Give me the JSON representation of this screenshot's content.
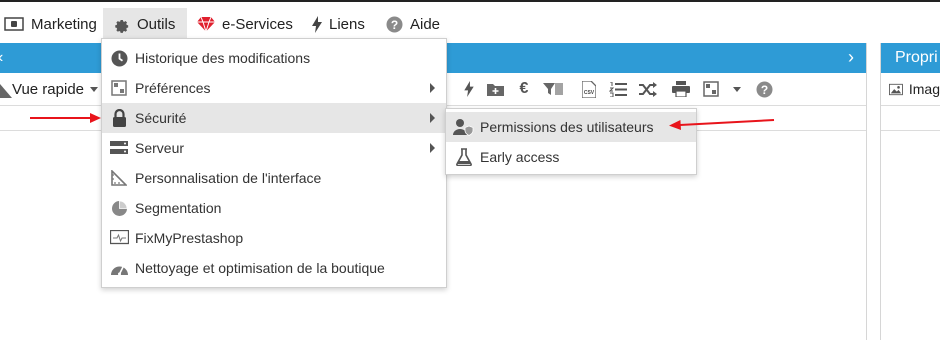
{
  "menubar": {
    "items": [
      {
        "label": "Marketing",
        "icon": "banknote-icon"
      },
      {
        "label": "Outils",
        "icon": "gear-icon"
      },
      {
        "label": "e-Services",
        "icon": "gem-icon"
      },
      {
        "label": "Liens",
        "icon": "bolt-icon"
      },
      {
        "label": "Aide",
        "icon": "question-icon"
      }
    ]
  },
  "toolbar": {
    "quick_view": "Vue rapide"
  },
  "right_panel": {
    "title": "Propri",
    "sub_label": "Imag"
  },
  "dropdown": {
    "items": [
      {
        "label": "Historique des modifications",
        "icon": "clock-icon",
        "has_submenu": false
      },
      {
        "label": "Préférences",
        "icon": "preferences-icon",
        "has_submenu": true
      },
      {
        "label": "Sécurité",
        "icon": "lock-icon",
        "has_submenu": true,
        "highlighted": true
      },
      {
        "label": "Serveur",
        "icon": "server-icon",
        "has_submenu": true
      },
      {
        "label": "Personnalisation de l'interface",
        "icon": "ruler-icon",
        "has_submenu": false
      },
      {
        "label": "Segmentation",
        "icon": "pie-icon",
        "has_submenu": false
      },
      {
        "label": "FixMyPrestashop",
        "icon": "monitor-icon",
        "has_submenu": false
      },
      {
        "label": "Nettoyage et optimisation de la boutique",
        "icon": "gauge-icon",
        "has_submenu": false
      }
    ]
  },
  "submenu": {
    "items": [
      {
        "label": "Permissions des utilisateurs",
        "icon": "user-shield-icon",
        "highlighted": true
      },
      {
        "label": "Early access",
        "icon": "flask-icon"
      }
    ]
  },
  "colors": {
    "accent": "#2e9bd6",
    "annotation_arrow": "#e8141b",
    "highlight": "#e6e6e6"
  }
}
